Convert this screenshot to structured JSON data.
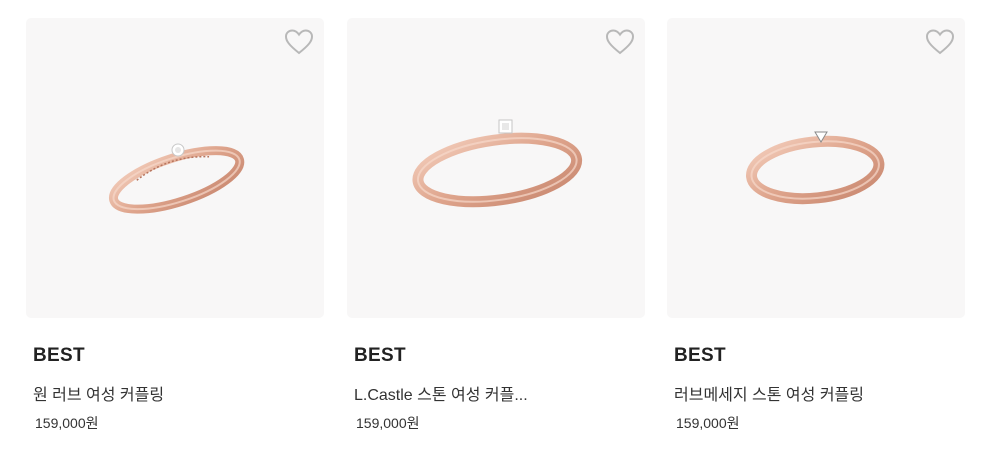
{
  "products": [
    {
      "badge": "BEST",
      "name": "원 러브 여성 커플링",
      "price": "159,000원",
      "image": "rose-gold-ring-with-single-stone"
    },
    {
      "badge": "BEST",
      "name": "L.Castle 스톤 여성 커플...",
      "price": "159,000원",
      "image": "rose-gold-ring-with-square-stone"
    },
    {
      "badge": "BEST",
      "name": "러브메세지 스톤 여성 커플링",
      "price": "159,000원",
      "image": "rose-gold-ring-with-triangle-stone"
    }
  ],
  "icons": {
    "wishlist": "heart-outline-icon"
  },
  "colors": {
    "card_bg": "#f8f7f7",
    "ring_gold": "#e8b39d",
    "heart_stroke": "#b8b8b8"
  }
}
